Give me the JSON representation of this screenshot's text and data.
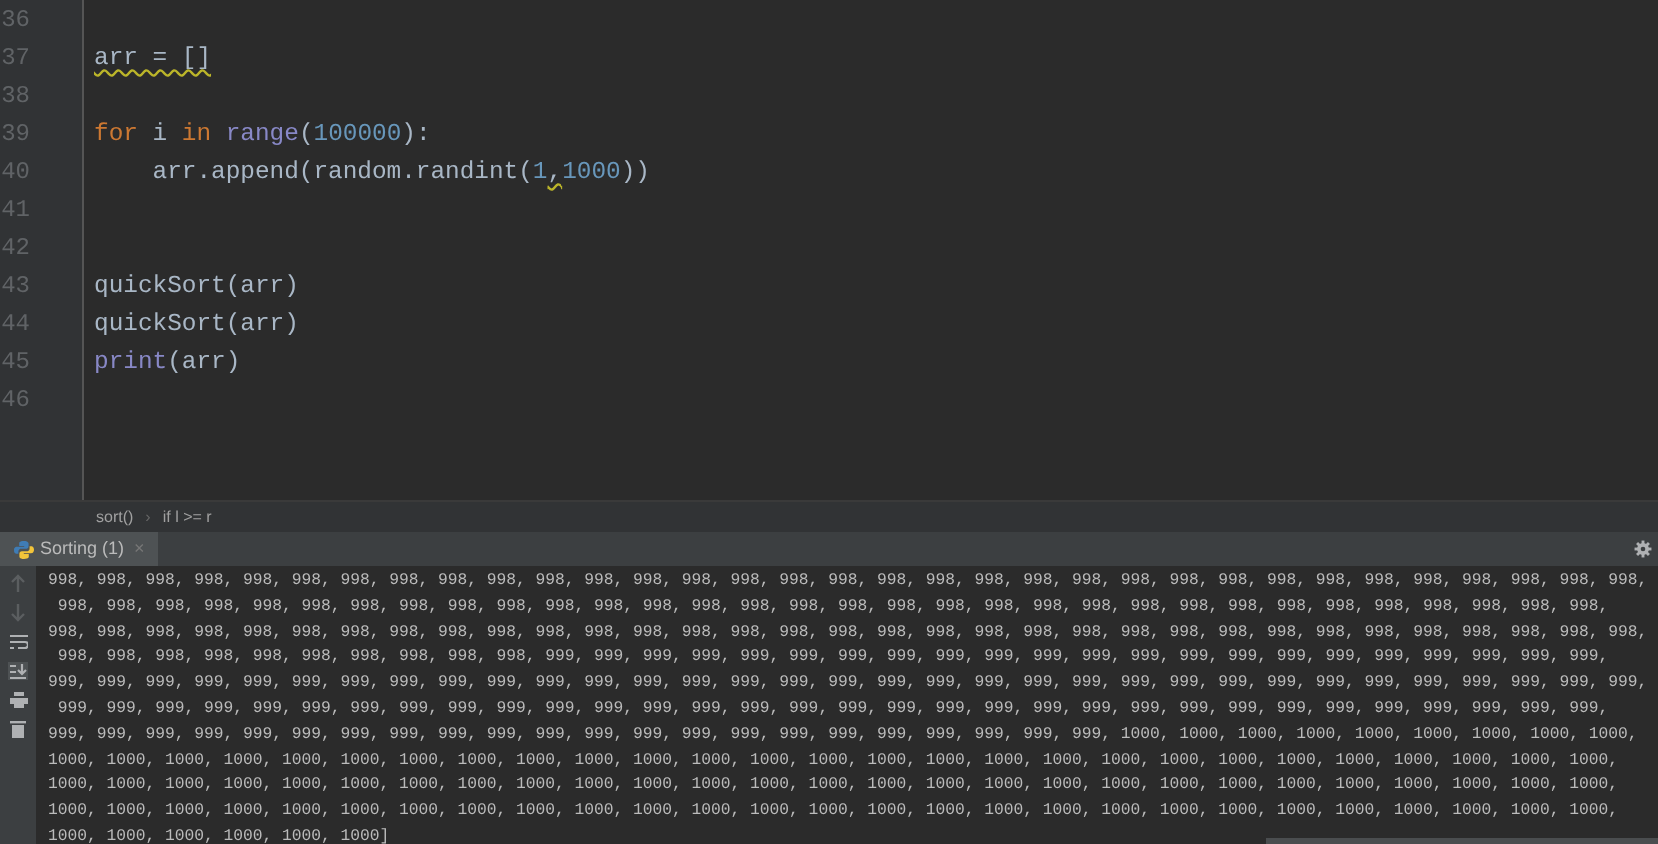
{
  "editor": {
    "lines": [
      {
        "number": "36"
      },
      {
        "number": "37",
        "tokens": [
          {
            "text": "arr = []",
            "kind": "plain",
            "warning": true
          }
        ]
      },
      {
        "number": "38"
      },
      {
        "number": "39",
        "tokens": [
          {
            "text": "for",
            "kind": "keyword",
            "warning": false
          },
          {
            "text": " i ",
            "kind": "plain",
            "warning": false
          },
          {
            "text": "in ",
            "kind": "keyword",
            "warning": false
          },
          {
            "text": "range",
            "kind": "builtin",
            "warning": false
          },
          {
            "text": "(",
            "kind": "plain",
            "warning": false
          },
          {
            "text": "100000",
            "kind": "number",
            "warning": false
          },
          {
            "text": "):",
            "kind": "plain",
            "warning": false
          }
        ]
      },
      {
        "number": "40",
        "tokens": [
          {
            "text": "    arr.append(random.randint(",
            "kind": "plain",
            "warning": false
          },
          {
            "text": "1",
            "kind": "number",
            "warning": false
          },
          {
            "text": ",",
            "kind": "plain",
            "warning": true
          },
          {
            "text": "1000",
            "kind": "number",
            "warning": false
          },
          {
            "text": "))",
            "kind": "plain",
            "warning": false
          }
        ]
      },
      {
        "number": "41"
      },
      {
        "number": "42"
      },
      {
        "number": "43",
        "tokens": [
          {
            "text": "quickSort(arr)",
            "kind": "plain",
            "warning": false
          }
        ]
      },
      {
        "number": "44",
        "tokens": [
          {
            "text": "quickSort(arr)",
            "kind": "plain",
            "warning": false
          }
        ]
      },
      {
        "number": "45",
        "tokens": [
          {
            "text": "print",
            "kind": "builtin",
            "warning": false
          },
          {
            "text": "(arr)",
            "kind": "plain",
            "warning": false
          }
        ]
      },
      {
        "number": "46"
      }
    ]
  },
  "breadcrumbs": {
    "items": [
      "sort()",
      "if l >= r"
    ],
    "separator": "›"
  },
  "run_tab": {
    "label": "Sorting (1)",
    "selected": true,
    "close": "×"
  },
  "console": {
    "lines": [
      "998, 998, 998, 998, 998, 998, 998, 998, 998, 998, 998, 998, 998, 998, 998, 998, 998, 998, 998, 998, 998, 998, 998, 998, 998, 998, 998, 998, 998, 998, 998, 998, 998,",
      " 998, 998, 998, 998, 998, 998, 998, 998, 998, 998, 998, 998, 998, 998, 998, 998, 998, 998, 998, 998, 998, 998, 998, 998, 998, 998, 998, 998, 998, 998, 998, 998,",
      "998, 998, 998, 998, 998, 998, 998, 998, 998, 998, 998, 998, 998, 998, 998, 998, 998, 998, 998, 998, 998, 998, 998, 998, 998, 998, 998, 998, 998, 998, 998, 998, 998,",
      " 998, 998, 998, 998, 998, 998, 998, 998, 998, 998, 999, 999, 999, 999, 999, 999, 999, 999, 999, 999, 999, 999, 999, 999, 999, 999, 999, 999, 999, 999, 999, 999,",
      "999, 999, 999, 999, 999, 999, 999, 999, 999, 999, 999, 999, 999, 999, 999, 999, 999, 999, 999, 999, 999, 999, 999, 999, 999, 999, 999, 999, 999, 999, 999, 999, 999,",
      " 999, 999, 999, 999, 999, 999, 999, 999, 999, 999, 999, 999, 999, 999, 999, 999, 999, 999, 999, 999, 999, 999, 999, 999, 999, 999, 999, 999, 999, 999, 999, 999,",
      "999, 999, 999, 999, 999, 999, 999, 999, 999, 999, 999, 999, 999, 999, 999, 999, 999, 999, 999, 999, 999, 999, 1000, 1000, 1000, 1000, 1000, 1000, 1000, 1000, 1000,",
      "1000, 1000, 1000, 1000, 1000, 1000, 1000, 1000, 1000, 1000, 1000, 1000, 1000, 1000, 1000, 1000, 1000, 1000, 1000, 1000, 1000, 1000, 1000, 1000, 1000, 1000, 1000,",
      "1000, 1000, 1000, 1000, 1000, 1000, 1000, 1000, 1000, 1000, 1000, 1000, 1000, 1000, 1000, 1000, 1000, 1000, 1000, 1000, 1000, 1000, 1000, 1000, 1000, 1000, 1000,",
      "1000, 1000, 1000, 1000, 1000, 1000, 1000, 1000, 1000, 1000, 1000, 1000, 1000, 1000, 1000, 1000, 1000, 1000, 1000, 1000, 1000, 1000, 1000, 1000, 1000, 1000, 1000,",
      "1000, 1000, 1000, 1000, 1000, 1000]"
    ]
  }
}
